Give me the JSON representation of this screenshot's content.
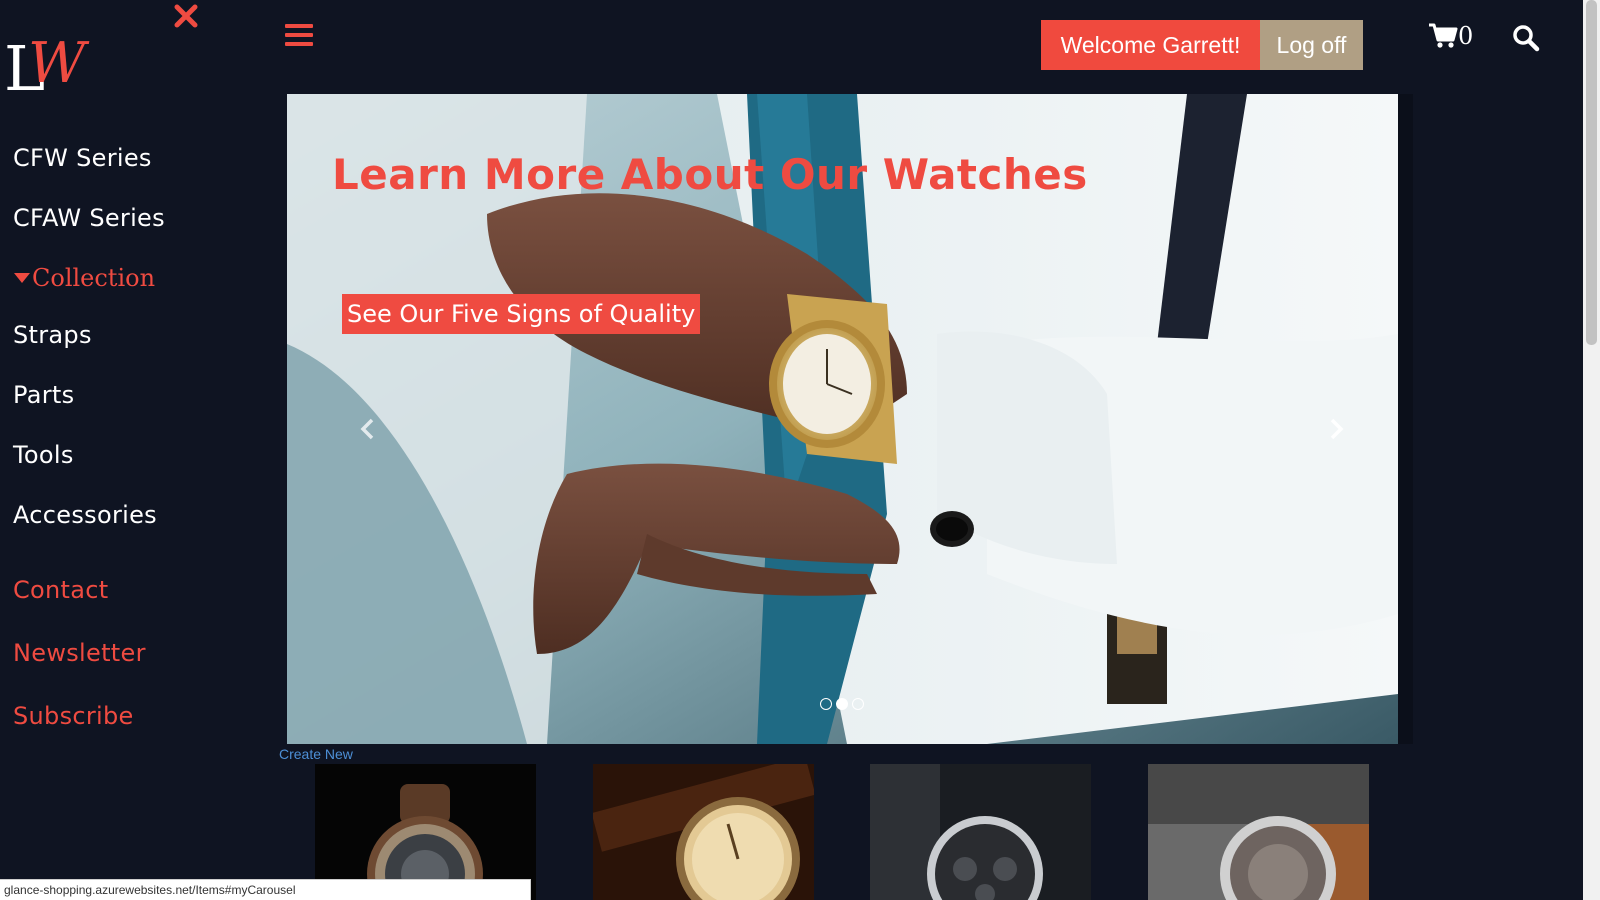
{
  "sidebar": {
    "logo_text": "LW",
    "items": [
      {
        "label": "CFW Series"
      },
      {
        "label": "CFAW Series"
      },
      {
        "label": "Collection"
      },
      {
        "label": "Straps"
      },
      {
        "label": "Parts"
      },
      {
        "label": "Tools"
      },
      {
        "label": "Accessories"
      },
      {
        "label": "Contact"
      },
      {
        "label": "Newsletter"
      },
      {
        "label": "Subscribe"
      }
    ]
  },
  "header": {
    "welcome_label": "Welcome Garrett!",
    "logoff_label": "Log off",
    "cart_count": "0"
  },
  "carousel": {
    "title": "Learn More About Our Watches",
    "cta_label": "See Our Five Signs of Quality",
    "active_slide": 2,
    "slide_count": 3
  },
  "main": {
    "create_new_label": "Create New"
  },
  "status_bar": {
    "url": "glance-shopping.azurewebsites.net/Items#myCarousel"
  },
  "colors": {
    "accent": "#ef4b41",
    "background": "#0f1422",
    "logoff": "#b09f84",
    "link": "#4d8fd6"
  },
  "icons": [
    "close-icon",
    "hamburger-icon",
    "cart-icon",
    "search-icon",
    "chevron-left-icon",
    "chevron-right-icon"
  ]
}
